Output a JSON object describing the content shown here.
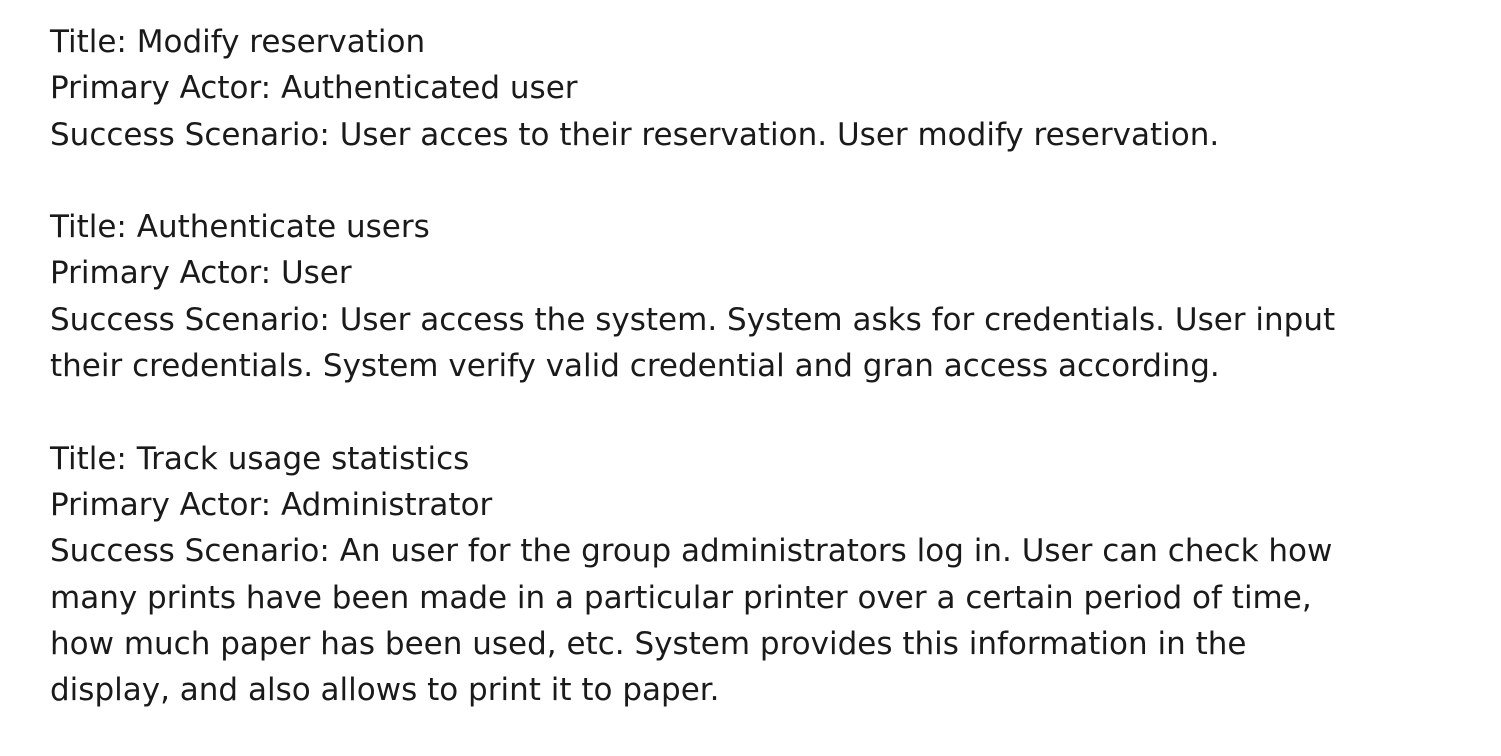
{
  "use_cases": [
    {
      "title": "Title: Modify reservation",
      "primary_actor": "Primary Actor: Authenticated user",
      "success_scenario": "Success Scenario: User acces to their reservation. User modify reservation."
    },
    {
      "title": "Title: Authenticate users",
      "primary_actor": "Primary Actor: User",
      "success_scenario_lines": [
        "Success Scenario: User access the system. System asks for credentials. User input",
        "their credentials. System verify valid credential and gran access according."
      ]
    },
    {
      "title": "Title: Track usage statistics",
      "primary_actor": "Primary Actor: Administrator",
      "success_scenario_lines": [
        "Success Scenario: An user for the group administrators log in. User can check how",
        "many prints have been made in a particular printer over a certain period of time,",
        "how much paper has been used, etc. System provides this information in the",
        "display, and also allows to print it to paper."
      ]
    }
  ]
}
